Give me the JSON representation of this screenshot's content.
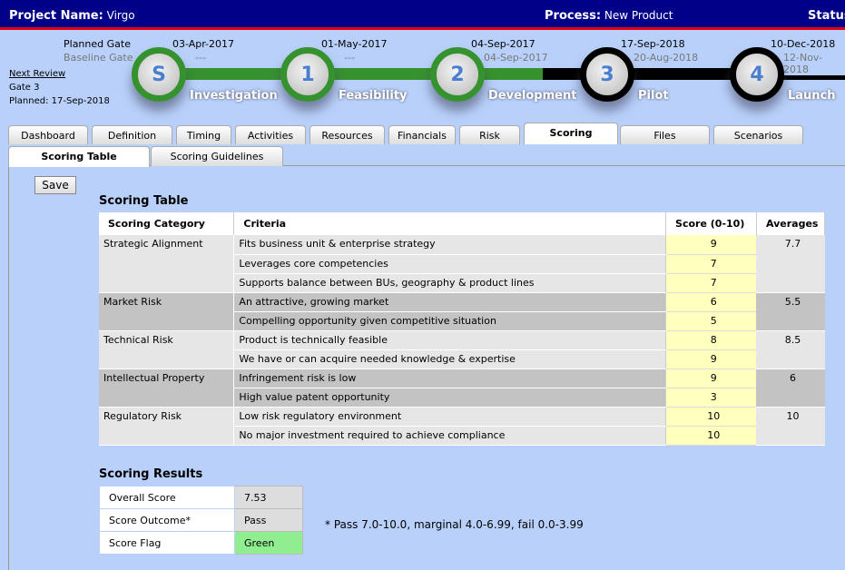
{
  "header": {
    "project_label": "Project Name:",
    "project": "Virgo",
    "process_label": "Process:",
    "process": "New Product",
    "status_label": "Status"
  },
  "gates": {
    "planned_label": "Planned Gate",
    "baseline_label": "Baseline Gate",
    "items": [
      {
        "letter": "S",
        "planned": "03-Apr-2017",
        "baseline": "---",
        "stage": "Investigation",
        "complete": true
      },
      {
        "letter": "1",
        "planned": "01-May-2017",
        "baseline": "---",
        "stage": "Feasibility",
        "complete": true
      },
      {
        "letter": "2",
        "planned": "04-Sep-2017",
        "baseline": "04-Sep-2017",
        "stage": "Development",
        "complete": true
      },
      {
        "letter": "3",
        "planned": "17-Sep-2018",
        "baseline": "20-Aug-2018",
        "stage": "Pilot",
        "complete": false
      },
      {
        "letter": "4",
        "planned": "10-Dec-2018",
        "baseline": "12-Nov-2018",
        "stage": "Launch",
        "complete": false
      }
    ]
  },
  "next_review": {
    "link": "Next Review",
    "gate": "Gate 3",
    "planned": "Planned:  17-Sep-2018"
  },
  "tabs": [
    "Dashboard",
    "Definition",
    "Timing",
    "Activities",
    "Resources",
    "Financials",
    "Risk",
    "Scoring",
    "Files",
    "Scenarios"
  ],
  "active_tab": "Scoring",
  "subtabs": [
    "Scoring Table",
    "Scoring Guidelines"
  ],
  "save_label": "Save",
  "scoring_table": {
    "title": "Scoring Table",
    "headers": [
      "Scoring Category",
      "Criteria",
      "Score (0-10)",
      "Averages"
    ],
    "groups": [
      {
        "category": "Strategic Alignment",
        "average": "7.7",
        "rows": [
          [
            "Fits business unit & enterprise strategy",
            "9"
          ],
          [
            "Leverages core competencies",
            "7"
          ],
          [
            "Supports balance between BUs, geography & product lines",
            "7"
          ]
        ]
      },
      {
        "category": "Market Risk",
        "average": "5.5",
        "rows": [
          [
            "An attractive, growing market",
            "6"
          ],
          [
            "Compelling opportunity given competitive situation",
            "5"
          ]
        ]
      },
      {
        "category": "Technical Risk",
        "average": "8.5",
        "rows": [
          [
            "Product is technically feasible",
            "8"
          ],
          [
            "We have or can acquire needed knowledge & expertise",
            "9"
          ]
        ]
      },
      {
        "category": "Intellectual Property",
        "average": "6",
        "rows": [
          [
            "Infringement risk is low",
            "9"
          ],
          [
            "High value patent opportunity",
            "3"
          ]
        ]
      },
      {
        "category": "Regulatory Risk",
        "average": "10",
        "rows": [
          [
            "Low risk regulatory environment",
            "10"
          ],
          [
            "No major investment required to achieve compliance",
            "10"
          ]
        ]
      }
    ]
  },
  "results": {
    "title": "Scoring Results",
    "rows": [
      {
        "label": "Overall Score",
        "value": "7.53"
      },
      {
        "label": "Score Outcome*",
        "value": "Pass"
      },
      {
        "label": "Score Flag",
        "value": "Green",
        "color": "#90ee90"
      }
    ],
    "note": "* Pass 7.0-10.0, marginal 4.0-6.99, fail 0.0-3.99"
  }
}
